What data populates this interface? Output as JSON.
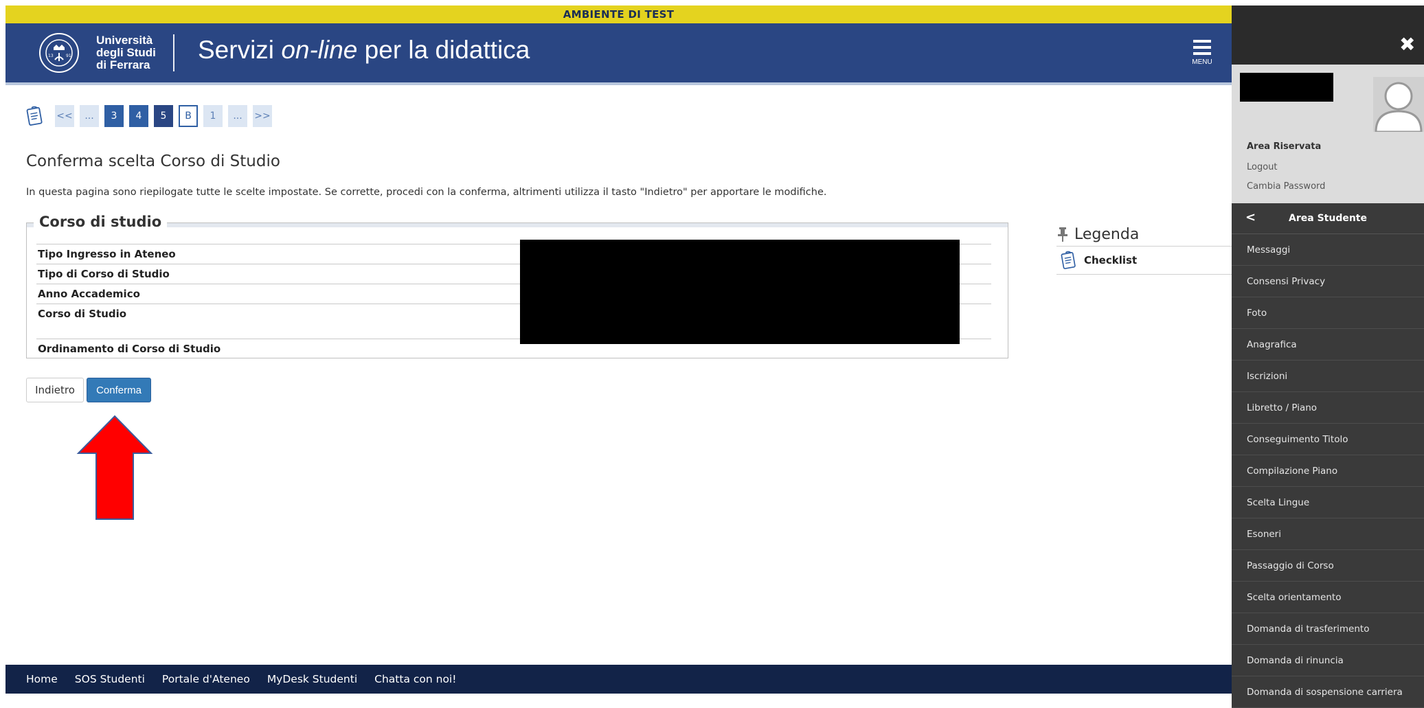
{
  "banner": "AMBIENTE DI TEST",
  "header": {
    "logo_line1": "Università",
    "logo_line2": "degli Studi",
    "logo_line3": "di Ferrara",
    "title_prefix": "Servizi ",
    "title_italic": "on-line",
    "title_suffix": " per la didattica",
    "menu_label": "MENU"
  },
  "wizard": {
    "steps": [
      "<<",
      "...",
      "3",
      "4",
      "5",
      "B",
      "1",
      "...",
      ">>"
    ]
  },
  "page": {
    "title": "Conferma scelta Corso di Studio",
    "intro": "In questa pagina sono riepilogate tutte le scelte impostate. Se corrette, procedi con la conferma, altrimenti utilizza il tasto \"Indietro\" per apportare le modifiche."
  },
  "fieldset": {
    "legend": "Corso di studio",
    "rows": [
      "Tipo Ingresso in Ateneo",
      "Tipo di Corso di Studio",
      "Anno Accademico",
      "Corso di Studio",
      "Ordinamento di Corso di Studio"
    ]
  },
  "buttons": {
    "back": "Indietro",
    "confirm": "Conferma"
  },
  "legend_panel": {
    "title": "Legenda",
    "item": "Checklist"
  },
  "footer": {
    "links": [
      "Home",
      "SOS Studenti",
      "Portale d'Ateneo",
      "MyDesk Studenti",
      "Chatta con noi!"
    ]
  },
  "side_panel": {
    "area_riservata": "Area Riservata",
    "logout": "Logout",
    "change_password": "Cambia Password",
    "menu_title": "Area Studente",
    "items": [
      "Messaggi",
      "Consensi Privacy",
      "Foto",
      "Anagrafica",
      "Iscrizioni",
      "Libretto / Piano",
      "Conseguimento Titolo",
      "Compilazione Piano",
      "Scelta Lingue",
      "Esoneri",
      "Passaggio di Corso",
      "Scelta orientamento",
      "Domanda di trasferimento",
      "Domanda di rinuncia",
      "Domanda di sospensione carriera"
    ]
  },
  "colors": {
    "banner": "#e4d31f",
    "header": "#2a4683",
    "footer": "#122348",
    "primary_button": "#337ab7",
    "arrow": "#ff0000"
  }
}
